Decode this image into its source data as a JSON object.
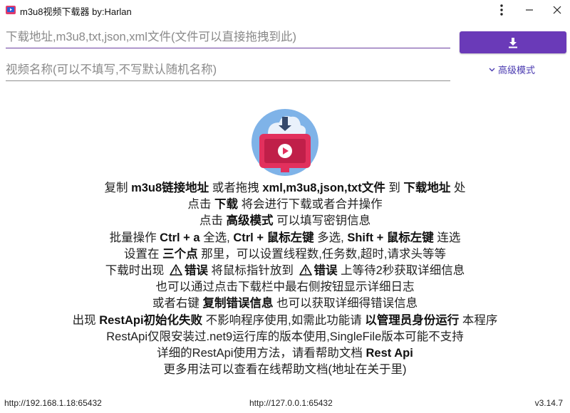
{
  "window": {
    "title": "m3u8视频下载器 by:Harlan",
    "icons": [
      "app-icon",
      "more-vertical-icon",
      "minimize-icon",
      "close-icon"
    ]
  },
  "form": {
    "url_placeholder": "下载地址,m3u8,txt,json,xml文件(文件可以直接拖拽到此)",
    "url_value": "",
    "name_placeholder": "视频名称(可以不填写,不写默认随机名称)",
    "name_value": "",
    "download_icon": "download-icon",
    "advanced_label": "高级模式",
    "accent_color": "#6a3ab8"
  },
  "help": {
    "l1": {
      "t1": "复制 ",
      "b1": "m3u8链接地址",
      "t2": " 或者拖拽 ",
      "b2": "xml,m3u8,json,txt文件",
      "t3": " 到 ",
      "b3": "下载地址",
      "t4": " 处"
    },
    "l2": {
      "t1": "点击 ",
      "b1": "下载",
      "t2": " 将会进行下载或者合并操作"
    },
    "l3": {
      "t1": "点击 ",
      "b1": "高级模式",
      "t2": " 可以填写密钥信息"
    },
    "l4": {
      "t1": "批量操作 ",
      "b1": "Ctrl + a",
      "t2": " 全选, ",
      "b2": "Ctrl + 鼠标左键",
      "t3": " 多选, ",
      "b3": "Shift + 鼠标左键",
      "t4": " 连选"
    },
    "l5": {
      "t1": "设置在 ",
      "b1": "三个点",
      "t2": " 那里，可以设置线程数,任务数,超时,请求头等等"
    },
    "l6": {
      "t1": "下载时出现 ",
      "b1": "错误",
      "t2": " 将鼠标指针放到 ",
      "b2": "错误",
      "t3": " 上等待2秒获取详细信息"
    },
    "l7": {
      "t1": "也可以通过点击下载栏中最右侧按钮显示详细日志"
    },
    "l8": {
      "t1": "或者右键 ",
      "b1": "复制错误信息",
      "t2": " 也可以获取详细得错误信息"
    },
    "l9": {
      "t1": "出现 ",
      "b1": "RestApi初始化失败",
      "t2": " 不影响程序使用,如需此功能请 ",
      "b2": "以管理员身份运行",
      "t3": " 本程序"
    },
    "l10": {
      "t1": "RestApi仅限安装过.net9运行库的版本使用,SingleFile版本可能不支持"
    },
    "l11": {
      "t1": "详细的RestApi使用方法，请看帮助文档 ",
      "b1": "Rest Api"
    },
    "l12": {
      "t1": "更多用法可以查看在线帮助文档(地址在关于里)"
    }
  },
  "status": {
    "left": "http://192.168.1.18:65432",
    "middle": "http://127.0.0.1:65432",
    "version": "v3.14.7"
  }
}
